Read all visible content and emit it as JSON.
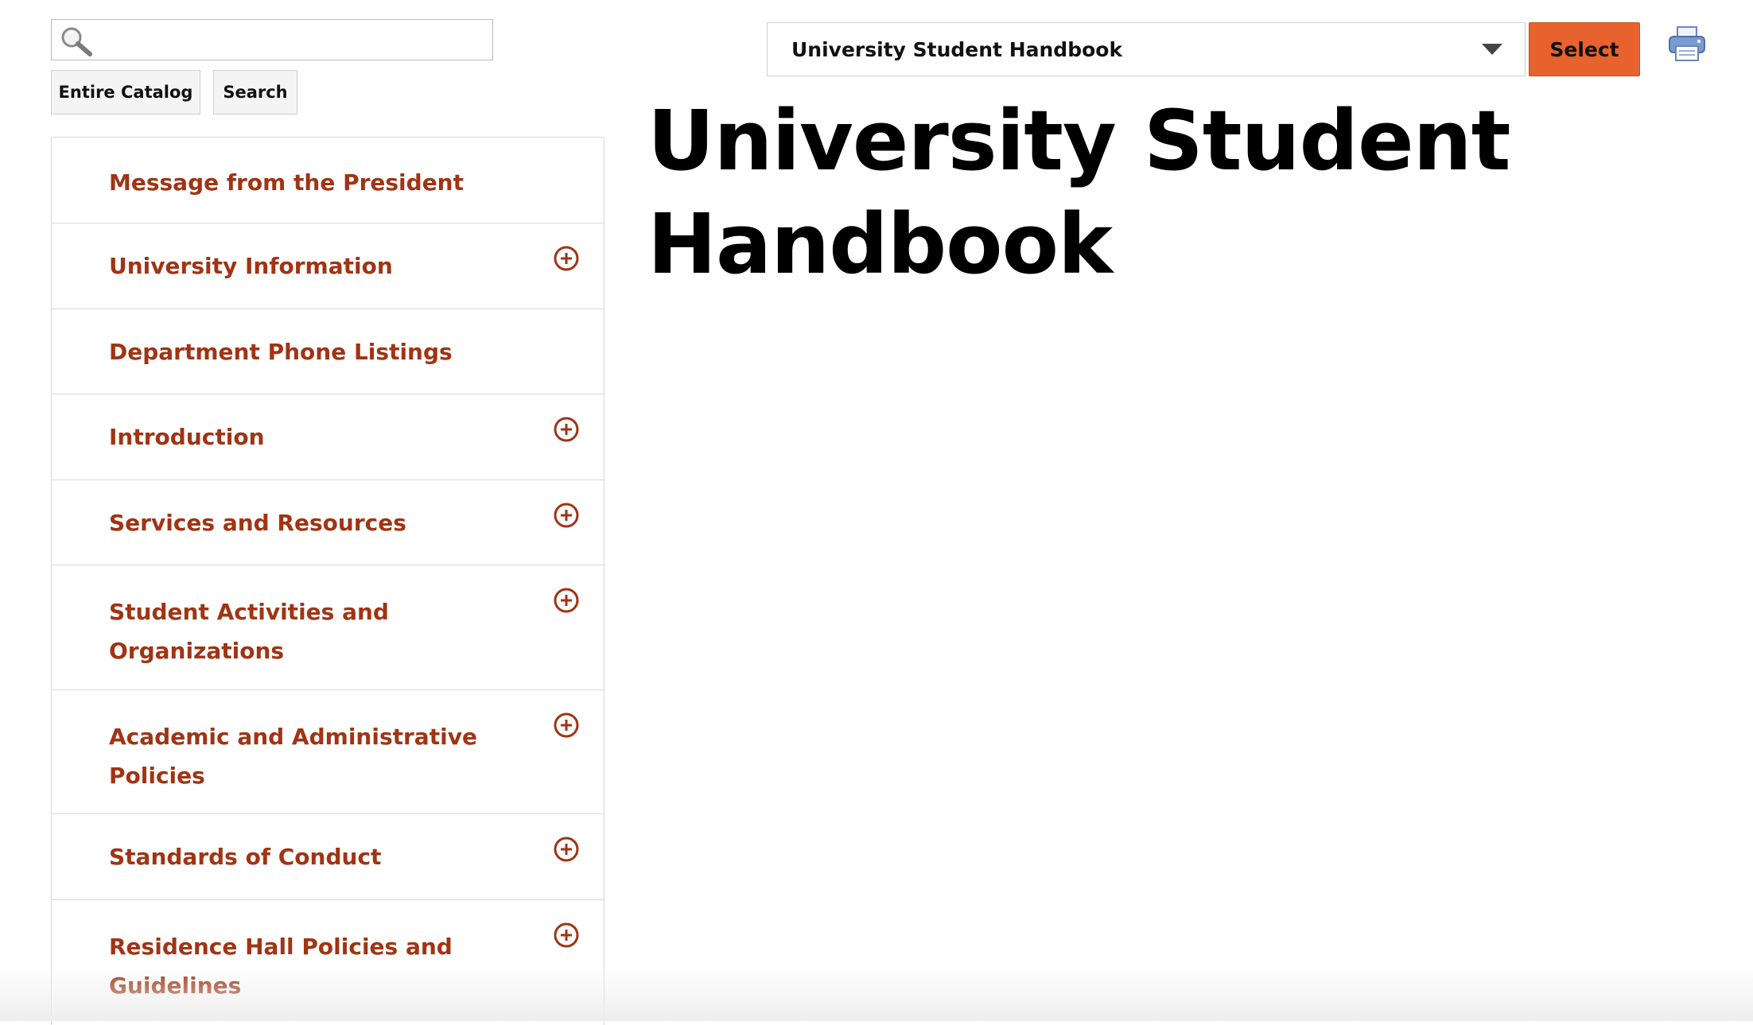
{
  "search": {
    "value": "",
    "placeholder": "",
    "scope_label": "Entire Catalog",
    "button_label": "Search"
  },
  "catalog": {
    "selected": "University Student Handbook",
    "select_label": "Select"
  },
  "page": {
    "title": "University Student Handbook"
  },
  "nav": {
    "items": [
      {
        "label": "Message from the President",
        "expandable": false
      },
      {
        "label": "University Information",
        "expandable": true
      },
      {
        "label": "Department Phone Listings",
        "expandable": false
      },
      {
        "label": "Introduction",
        "expandable": true
      },
      {
        "label": "Services and Resources",
        "expandable": true
      },
      {
        "label": "Student Activities and Organizations",
        "expandable": true
      },
      {
        "label": "Academic and Administrative Policies",
        "expandable": true
      },
      {
        "label": "Standards of Conduct",
        "expandable": true
      },
      {
        "label": "Residence Hall Policies and Guidelines",
        "expandable": true
      }
    ]
  },
  "colors": {
    "nav_link": "#a03414",
    "select_button": "#e8622e",
    "title": "#000000",
    "border": "#d9d9d9"
  },
  "icons": {
    "search": "magnifier-icon",
    "print": "printer-icon",
    "expand": "plus-circle-icon",
    "dropdown": "caret-down-icon"
  }
}
